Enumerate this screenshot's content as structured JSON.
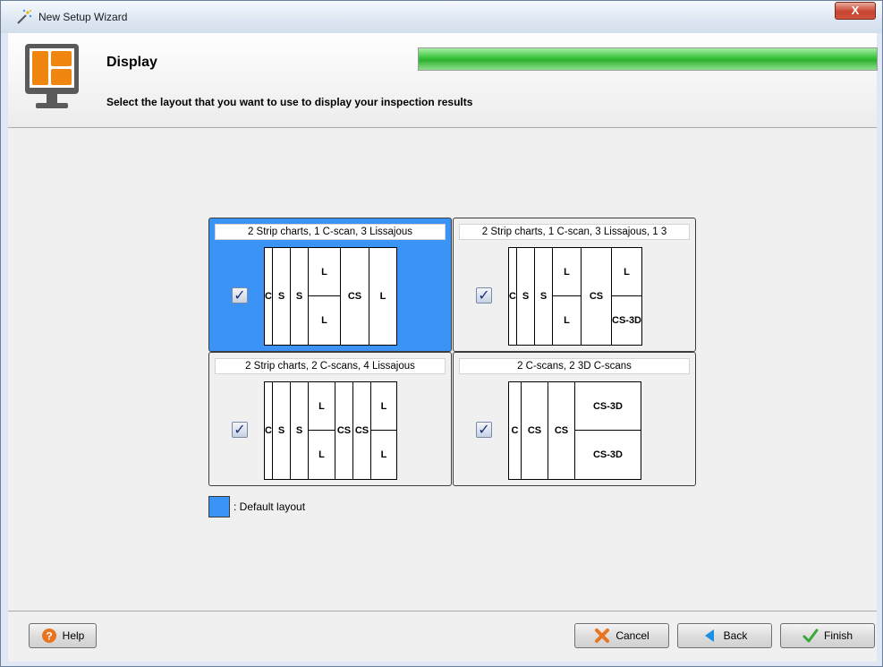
{
  "window": {
    "title": "New Setup Wizard",
    "close_label": "X"
  },
  "header": {
    "title": "Display",
    "subtitle": "Select the layout that you want to use to display your inspection results",
    "progress_fraction": 1.0
  },
  "layouts": [
    {
      "label": "2 Strip charts, 1 C-scan, 3 Lissajous",
      "checked": true,
      "selected": true,
      "preview_text": [
        "C",
        "S",
        "S",
        "L",
        "L",
        "CS",
        "L"
      ]
    },
    {
      "label": "2 Strip charts, 1 C-scan, 3 Lissajous, 1 3",
      "checked": true,
      "selected": false,
      "preview_text": [
        "C",
        "S",
        "S",
        "L",
        "L",
        "CS",
        "L",
        "CS-3D"
      ]
    },
    {
      "label": "2 Strip charts, 2 C-scans, 4 Lissajous",
      "checked": true,
      "selected": false,
      "preview_text": [
        "C",
        "S",
        "S",
        "L",
        "L",
        "CS",
        "CS",
        "L",
        "L"
      ]
    },
    {
      "label": "2 C-scans, 2 3D C-scans",
      "checked": true,
      "selected": false,
      "preview_text": [
        "C",
        "CS",
        "CS",
        "CS-3D",
        "CS-3D"
      ]
    }
  ],
  "legend": {
    "text": ": Default layout",
    "color": "#3b94f5"
  },
  "footer": {
    "help_label": "Help",
    "cancel_label": "Cancel",
    "back_label": "Back",
    "finish_label": "Finish"
  },
  "colors": {
    "selected_tile": "#3b94f5",
    "progress": "#39c239",
    "monitor_accent": "#f0850f"
  }
}
